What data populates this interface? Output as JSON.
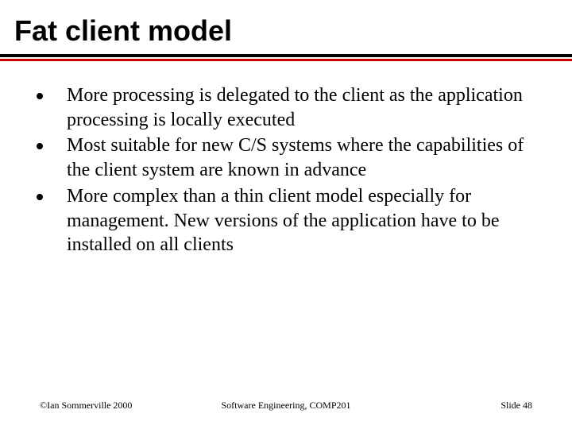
{
  "title": "Fat client model",
  "bullets": [
    "More processing is delegated to the client as the application processing is locally executed",
    "Most suitable for new C/S systems where the capabilities of the client system are known in advance",
    "More complex than a thin client model especially for management. New versions of the application have to be installed on all clients"
  ],
  "footer": {
    "left": "©Ian Sommerville 2000",
    "center": "Software Engineering, COMP201",
    "right": "Slide 48"
  }
}
